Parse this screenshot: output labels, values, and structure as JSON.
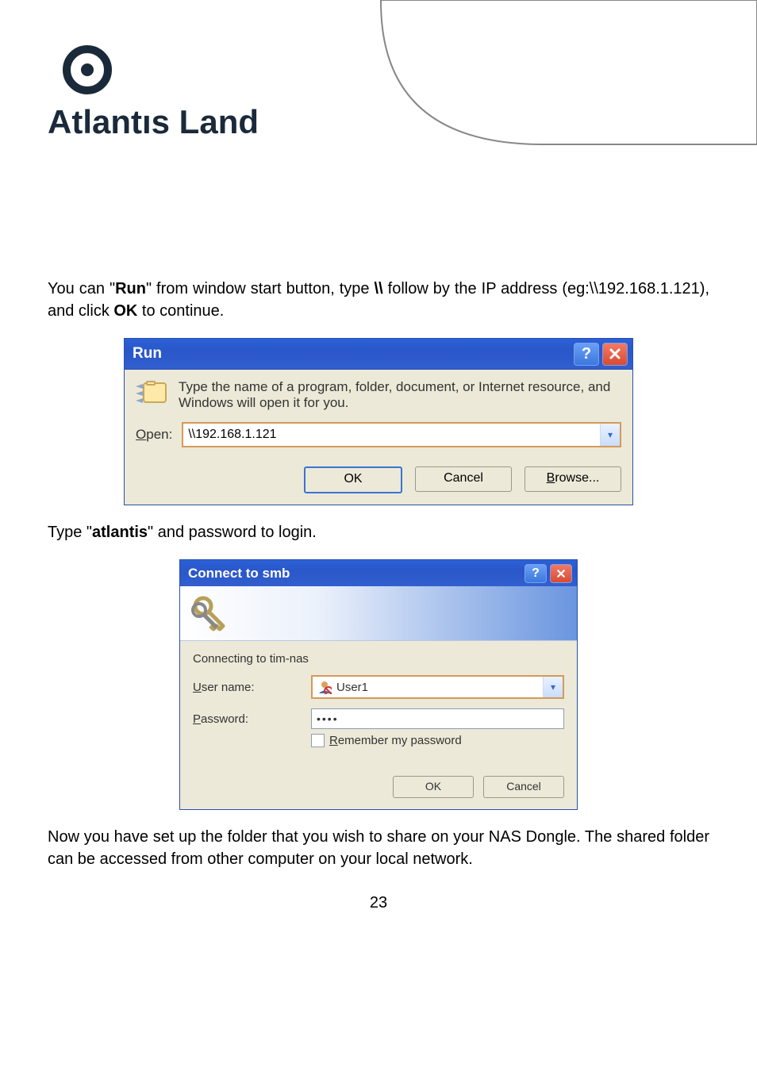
{
  "logo_text": "Atlantıs Land",
  "body": {
    "p1_pre": "You  can  \"",
    "p1_b1": "Run",
    "p1_mid1": "\"  from  window  start  button,  type  ",
    "p1_b2": "\\\\",
    "p1_mid2": "  follow  by  the  IP  address (eg:\\\\192.168.1.121), and click ",
    "p1_b3": "OK",
    "p1_post": " to continue.",
    "p2_pre": "Type \"",
    "p2_b1": "atlantis",
    "p2_post": "\" and password to login.",
    "p3": "Now  you  have  set  up  the  folder  that  you  wish  to  share  on  your  NAS  Dongle.  The shared folder can be accessed from other computer on your local network.",
    "page_number": "23"
  },
  "run_dialog": {
    "title": "Run",
    "desc": "Type the name of a program, folder, document, or Internet resource, and Windows will open it for you.",
    "open_label_u": "O",
    "open_label_rest": "pen:",
    "value": "\\\\192.168.1.121",
    "ok": "OK",
    "cancel": "Cancel",
    "browse_u": "B",
    "browse_rest": "rowse..."
  },
  "conn_dialog": {
    "title": "Connect to smb",
    "connecting": "Connecting to tim-nas",
    "user_label_u": "U",
    "user_label_rest": "ser name:",
    "pass_label_u": "P",
    "pass_label_rest": "assword:",
    "user_value": "User1",
    "pass_value": "••••",
    "remember_u": "R",
    "remember_rest": "emember my password",
    "ok": "OK",
    "cancel": "Cancel"
  }
}
